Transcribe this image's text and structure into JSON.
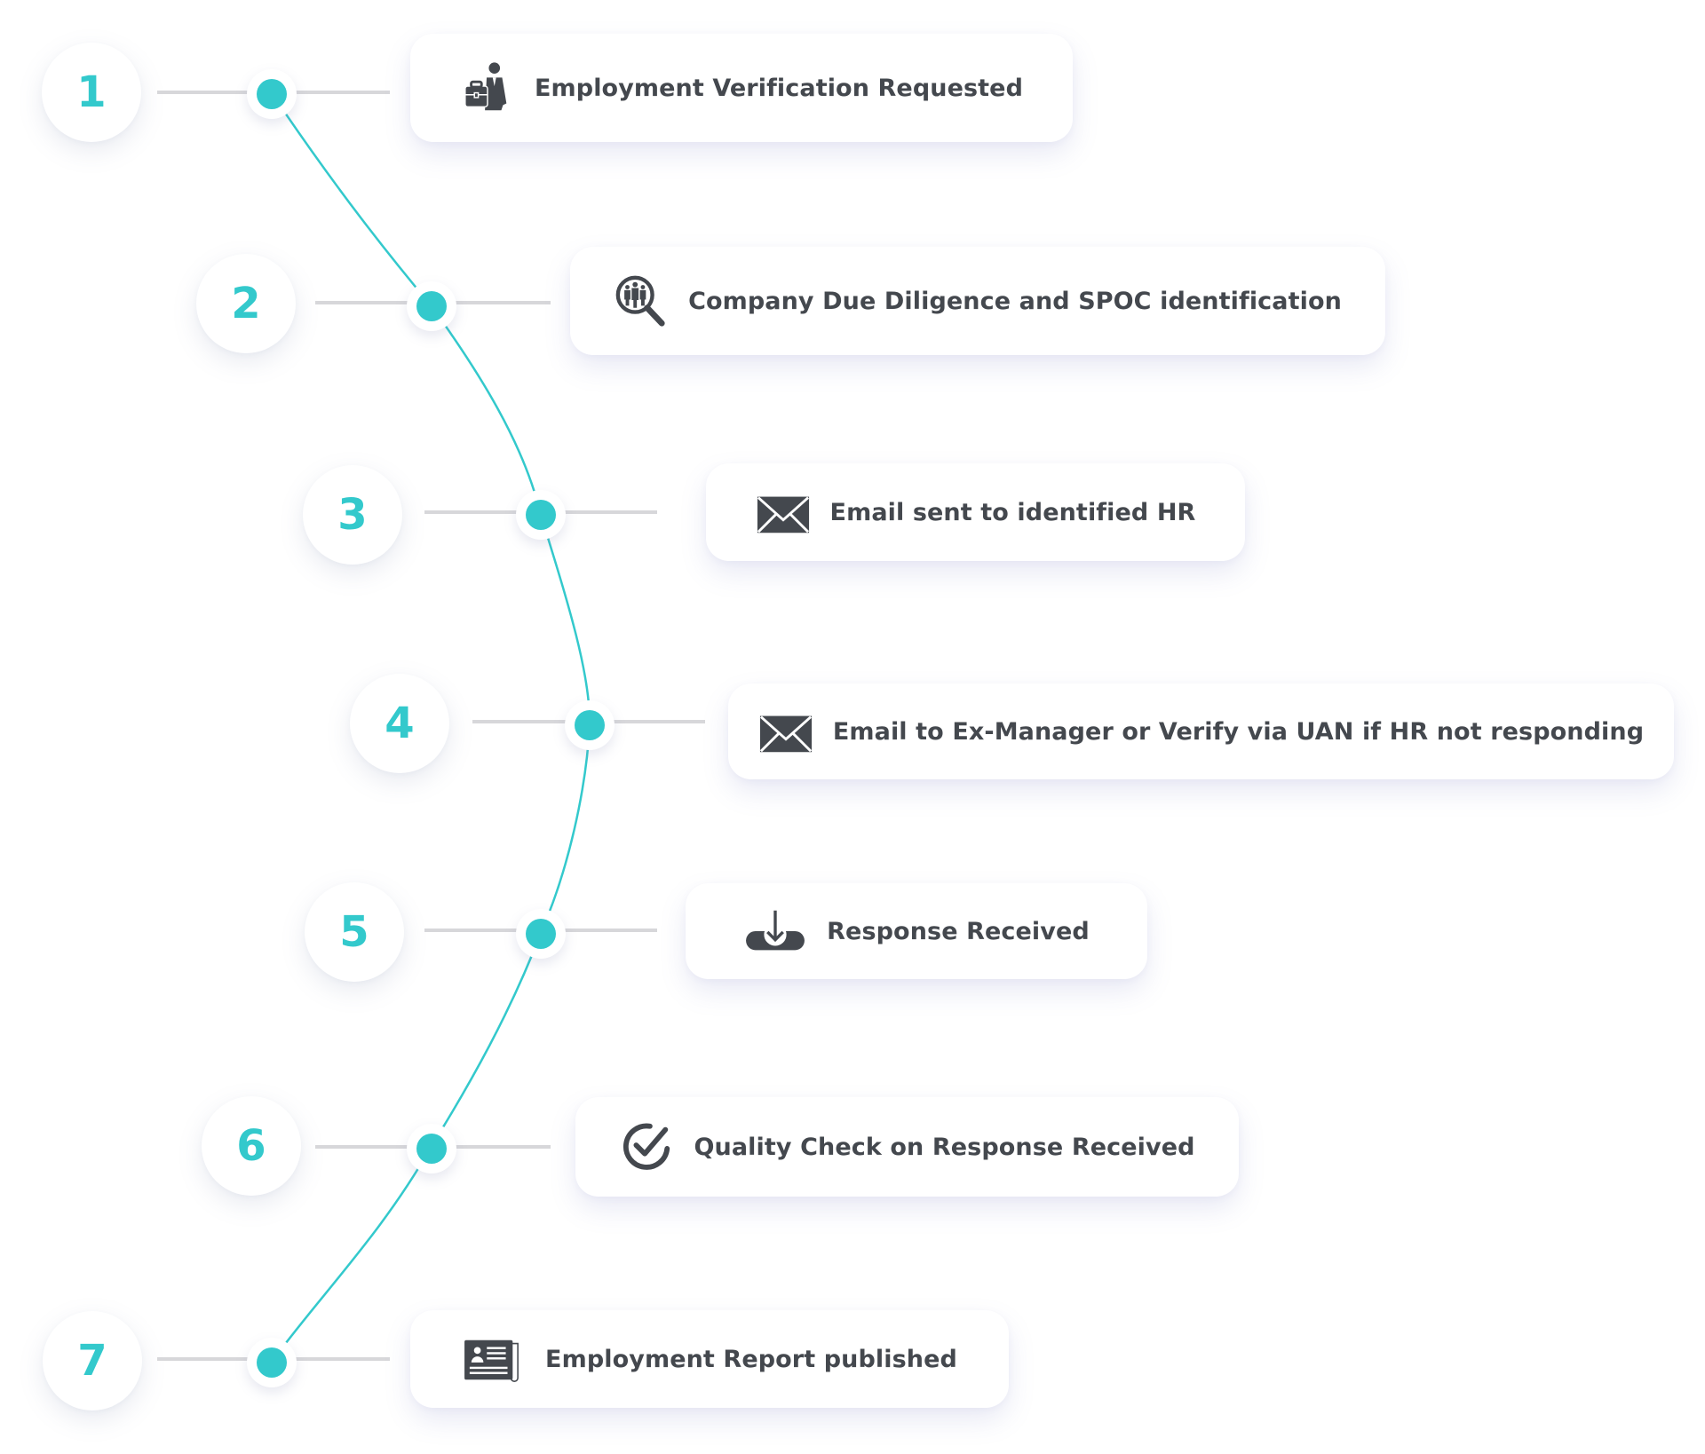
{
  "diagram": {
    "type": "process-timeline",
    "accent_color": "#33c9cc",
    "text_color": "#44484e",
    "connector_color": "#d7d7da",
    "steps": [
      {
        "number": "1",
        "label": "Employment Verification Requested",
        "icon": "businessman-briefcase-icon"
      },
      {
        "number": "2",
        "label": "Company Due Diligence and SPOC identification",
        "icon": "search-people-icon"
      },
      {
        "number": "3",
        "label": "Email sent to identified HR",
        "icon": "envelope-icon"
      },
      {
        "number": "4",
        "label": "Email to Ex-Manager or Verify via UAN if HR not responding",
        "icon": "envelope-icon"
      },
      {
        "number": "5",
        "label": "Response Received",
        "icon": "download-tray-icon"
      },
      {
        "number": "6",
        "label": "Quality Check on Response Received",
        "icon": "check-circle-icon"
      },
      {
        "number": "7",
        "label": "Employment Report published",
        "icon": "report-document-icon"
      }
    ]
  }
}
